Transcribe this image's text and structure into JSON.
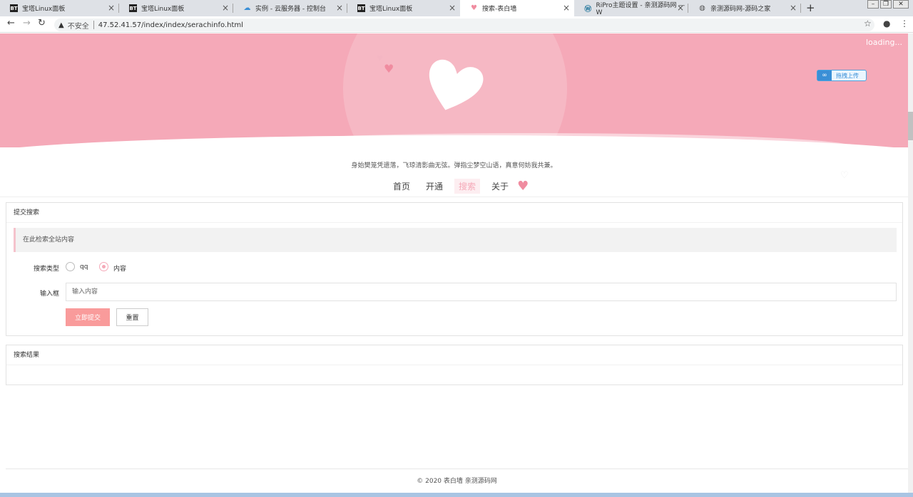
{
  "browser": {
    "tabs": [
      {
        "title": "宝塔Linux面板",
        "favicon": "bt-logo-icon"
      },
      {
        "title": "宝塔Linux面板",
        "favicon": "bt-logo-icon"
      },
      {
        "title": "实例 - 云服务器 - 控制台",
        "favicon": "cloud-icon"
      },
      {
        "title": "宝塔Linux面板",
        "favicon": "bt-logo-icon"
      },
      {
        "title": "搜索-表白墙",
        "favicon": "heart-icon"
      },
      {
        "title": "RiPro主题设置 - 亲测源码网 — W",
        "favicon": "wordpress-icon"
      },
      {
        "title": "亲测源码网-源码之家",
        "favicon": "globe-icon"
      }
    ],
    "new_tab_label": "+",
    "insecure_label": "不安全",
    "url": "47.52.41.57/index/index/serachinfo.html"
  },
  "banner": {
    "loading_text": "loading...",
    "upload_label": "拖拽上传"
  },
  "motto": "身始樊笼凭遗落，飞琼清影曲无弦。弹指尘梦空山语，真意何妨我共兼。",
  "nav": {
    "items": [
      "首页",
      "开通",
      "搜索",
      "关于"
    ],
    "active": "搜索"
  },
  "search_form": {
    "title": "提交搜索",
    "hint": "在此检索全站内容",
    "type_label": "搜索类型",
    "type_options": [
      "qq",
      "内容"
    ],
    "type_selected": "内容",
    "input_label": "输入框",
    "input_placeholder": "输入内容",
    "submit_label": "立即提交",
    "reset_label": "重置"
  },
  "results": {
    "title": "搜索结果"
  },
  "footer": {
    "text": "© 2020 表白墙  亲测源码网"
  },
  "colors": {
    "brand_pink": "#f5a9b8",
    "button_pink": "#f99b9b"
  }
}
